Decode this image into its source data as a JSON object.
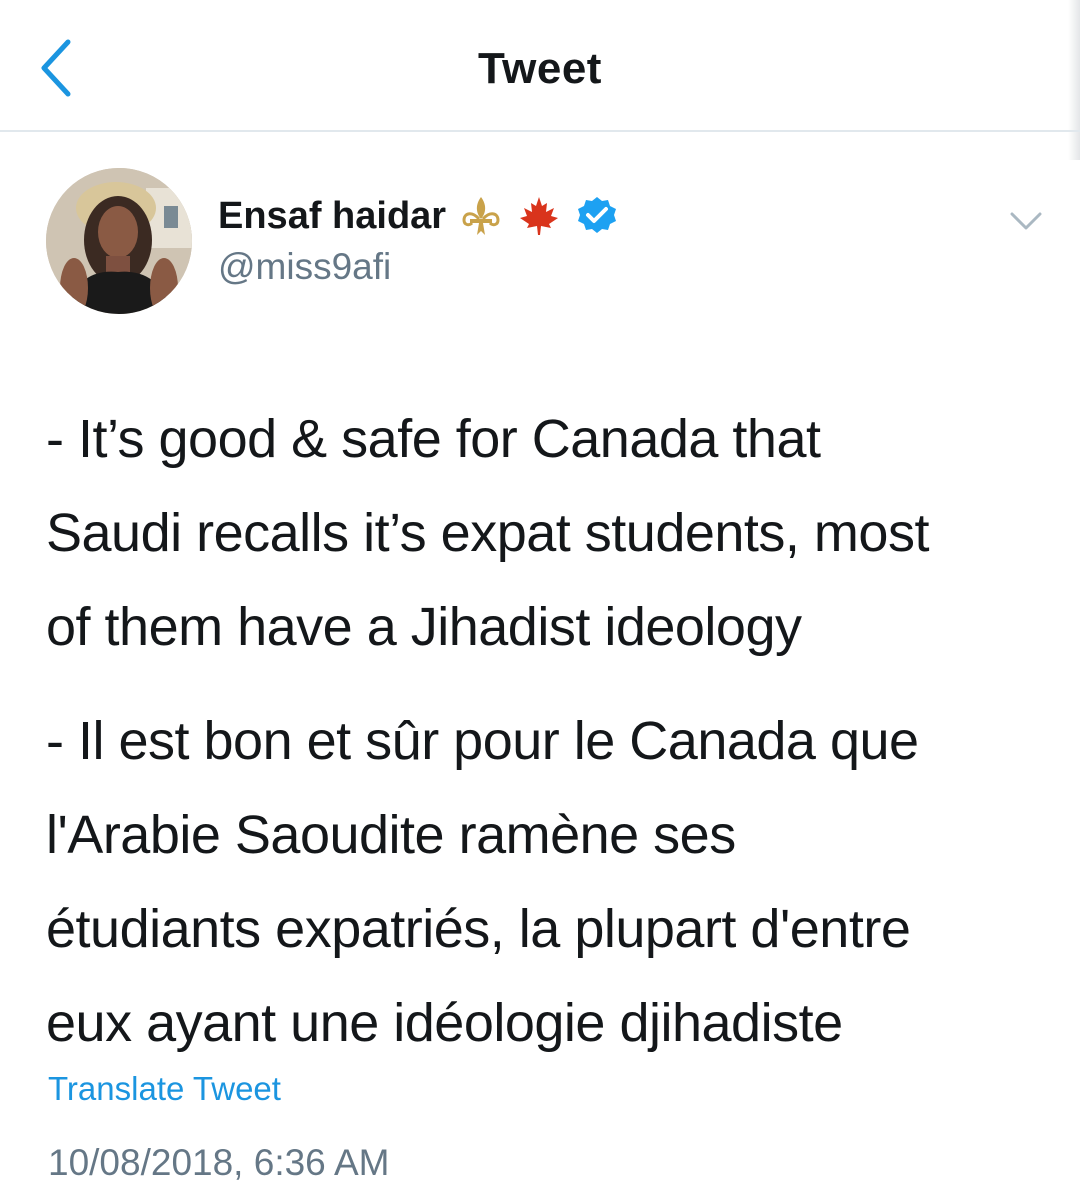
{
  "nav": {
    "title": "Tweet",
    "back_icon": "chevron-left-icon"
  },
  "author": {
    "display_name": "Ensaf haidar",
    "handle": "@miss9afi",
    "badges": [
      "fleur-de-lis-icon",
      "maple-leaf-icon",
      "verified-badge-icon"
    ],
    "menu_icon": "chevron-down-icon"
  },
  "tweet": {
    "paragraphs": [
      "- It’s good & safe for Canada that\nSaudi recalls it’s expat students, most\nof them have a Jihadist ideology",
      "- Il est bon et sûr pour le Canada que\nl'Arabie Saoudite ramène ses\nétudiants expatriés, la plupart d'entre\neux ayant une idéologie djihadiste"
    ],
    "translate_label": "Translate Tweet",
    "timestamp": "10/08/2018, 6:36 AM"
  },
  "colors": {
    "link_blue": "#1b95e0",
    "verified_blue": "#1da1f2",
    "secondary_text": "#657786",
    "divider": "#e1e8ed",
    "maple_red": "#d9341c",
    "gold": "#c9a24a"
  }
}
